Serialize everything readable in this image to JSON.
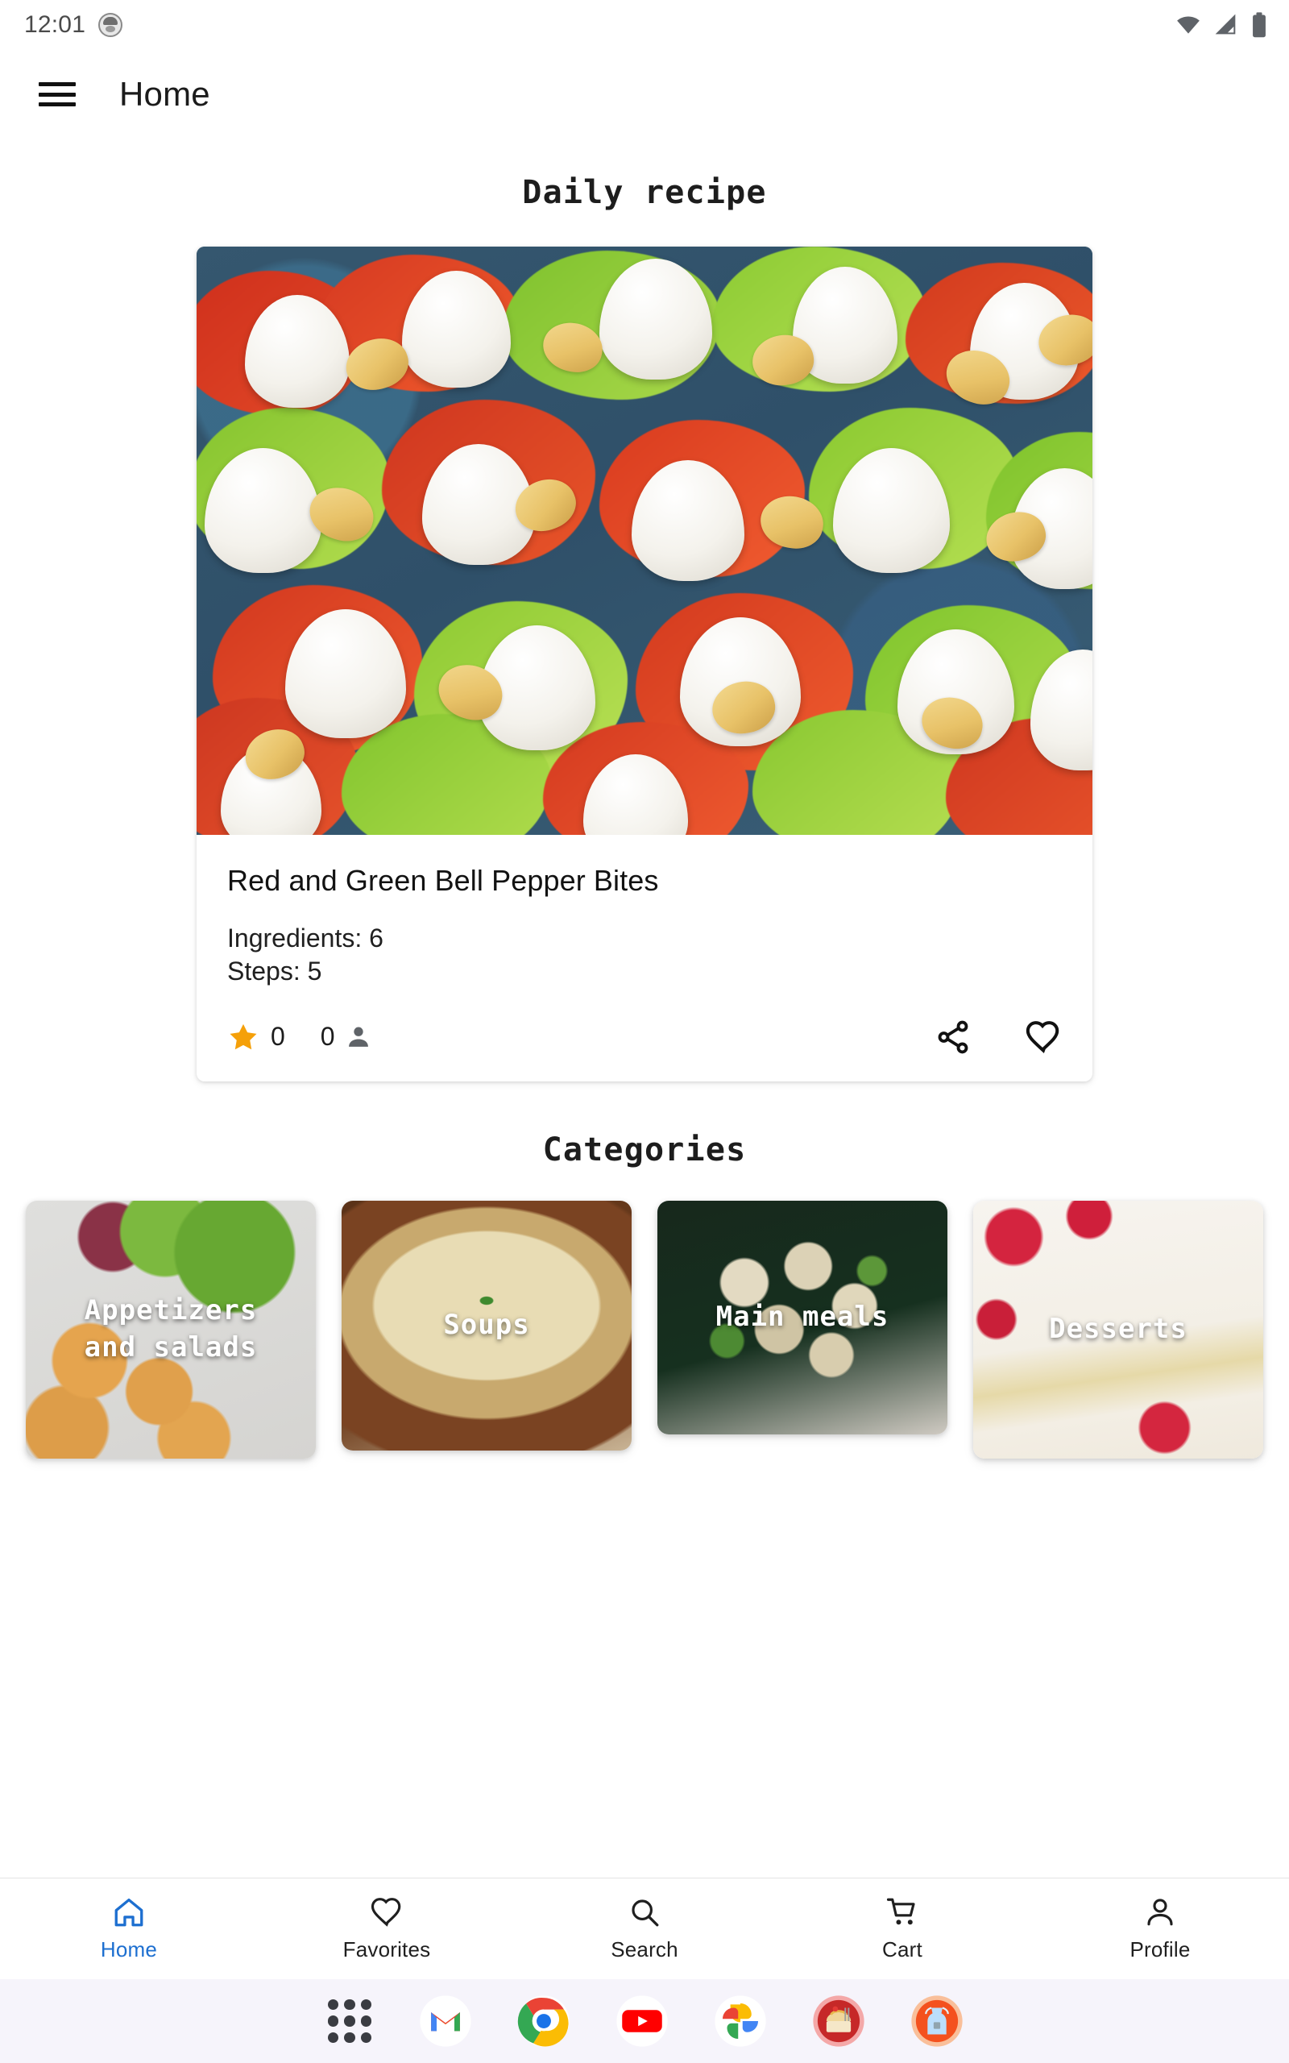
{
  "status_bar": {
    "time": "12:01",
    "avatar_icon": "profile-avatar-icon",
    "wifi_icon": "wifi-icon",
    "signal_icon": "cell-signal-icon",
    "battery_icon": "battery-full-icon"
  },
  "app_bar": {
    "menu_icon": "hamburger-menu-icon",
    "title": "Home"
  },
  "sections": {
    "daily_recipe_heading": "Daily recipe",
    "categories_heading": "Categories"
  },
  "recipe_card": {
    "image_alt": "Red and green bell pepper bites with cream cheese on blue plate",
    "title": "Red and Green Bell Pepper Bites",
    "ingredients_line": "Ingredients: 6",
    "steps_line": "Steps: 5",
    "rating_value": "0",
    "rating_count": "0",
    "star_icon": "star-filled-icon",
    "person_icon": "person-icon",
    "share_icon": "share-icon",
    "favorite_icon": "heart-outline-icon",
    "star_color": "#f5a009"
  },
  "categories": [
    {
      "label": "Appetizers\nand salads",
      "image_alt": "Fried croquettes with green salad"
    },
    {
      "label": "Soups",
      "image_alt": "Creamy soup in brown ceramic bowl with parsley"
    },
    {
      "label": "Main meals",
      "image_alt": "Wild rice pilaf with herbs on dark plate"
    },
    {
      "label": "Desserts",
      "image_alt": "Cheesecake slice with whipped cream and raspberries"
    }
  ],
  "bottom_nav": {
    "active_color": "#1d6fd0",
    "items": [
      {
        "label": "Home",
        "icon": "home-icon",
        "active": true
      },
      {
        "label": "Favorites",
        "icon": "heart-outline-icon",
        "active": false
      },
      {
        "label": "Search",
        "icon": "search-icon",
        "active": false
      },
      {
        "label": "Cart",
        "icon": "shopping-cart-icon",
        "active": false
      },
      {
        "label": "Profile",
        "icon": "person-outline-icon",
        "active": false
      }
    ]
  },
  "dock": {
    "items": [
      {
        "name": "app-drawer-icon"
      },
      {
        "name": "gmail-icon"
      },
      {
        "name": "chrome-icon"
      },
      {
        "name": "youtube-icon"
      },
      {
        "name": "google-photos-icon"
      },
      {
        "name": "recipe-app-icon"
      },
      {
        "name": "apron-app-icon"
      }
    ]
  }
}
